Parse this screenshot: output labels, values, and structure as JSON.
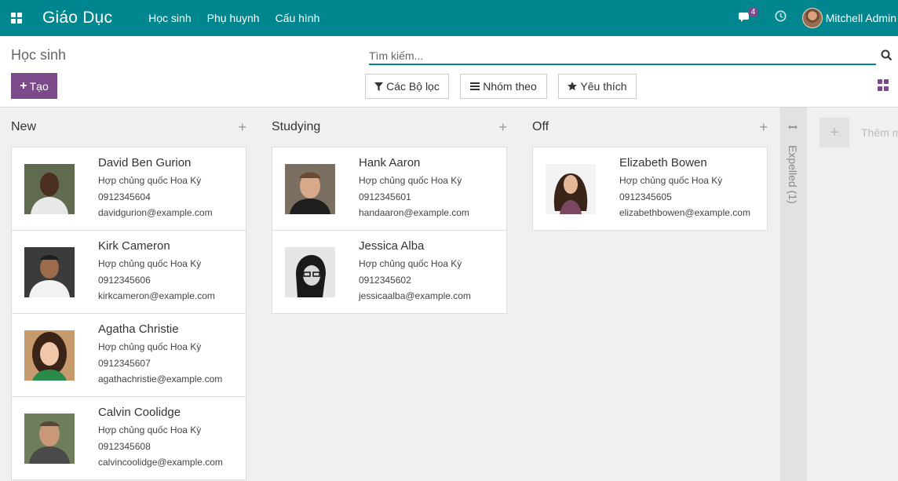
{
  "navbar": {
    "brand": "Giáo Dục",
    "menu": [
      "Học sinh",
      "Phụ huynh",
      "Cấu hình"
    ],
    "chat_badge": "4",
    "user_name": "Mitchell Admin"
  },
  "control": {
    "title": "Học sinh",
    "create_label": "Tạo",
    "search_placeholder": "Tìm kiếm...",
    "filters_label": "Các Bộ lọc",
    "group_by_label": "Nhóm theo",
    "favorites_label": "Yêu thích"
  },
  "columns": [
    {
      "title": "New",
      "cards": [
        {
          "name": "David Ben Gurion",
          "country": "Hợp chủng quốc Hoa Kỳ",
          "phone": "0912345604",
          "email": "davidgurion@example.com"
        },
        {
          "name": "Kirk Cameron",
          "country": "Hợp chủng quốc Hoa Kỳ",
          "phone": "0912345606",
          "email": "kirkcameron@example.com"
        },
        {
          "name": "Agatha Christie",
          "country": "Hợp chủng quốc Hoa Kỳ",
          "phone": "0912345607",
          "email": "agathachristie@example.com"
        },
        {
          "name": "Calvin Coolidge",
          "country": "Hợp chủng quốc Hoa Kỳ",
          "phone": "0912345608",
          "email": "calvincoolidge@example.com"
        }
      ]
    },
    {
      "title": "Studying",
      "cards": [
        {
          "name": "Hank Aaron",
          "country": "Hợp chủng quốc Hoa Kỳ",
          "phone": "0912345601",
          "email": "handaaron@example.com"
        },
        {
          "name": "Jessica Alba",
          "country": "Hợp chủng quốc Hoa Kỳ",
          "phone": "0912345602",
          "email": "jessicaalba@example.com"
        }
      ]
    },
    {
      "title": "Off",
      "cards": [
        {
          "name": "Elizabeth Bowen",
          "country": "Hợp chủng quốc Hoa Kỳ",
          "phone": "0912345605",
          "email": "elizabethbowen@example.com"
        }
      ]
    }
  ],
  "folded_column": {
    "label": "Expelled (1)"
  },
  "add_column": {
    "label": "Thêm m"
  },
  "colors": {
    "navbar": "#00868e",
    "accent": "#7c4a8a"
  }
}
